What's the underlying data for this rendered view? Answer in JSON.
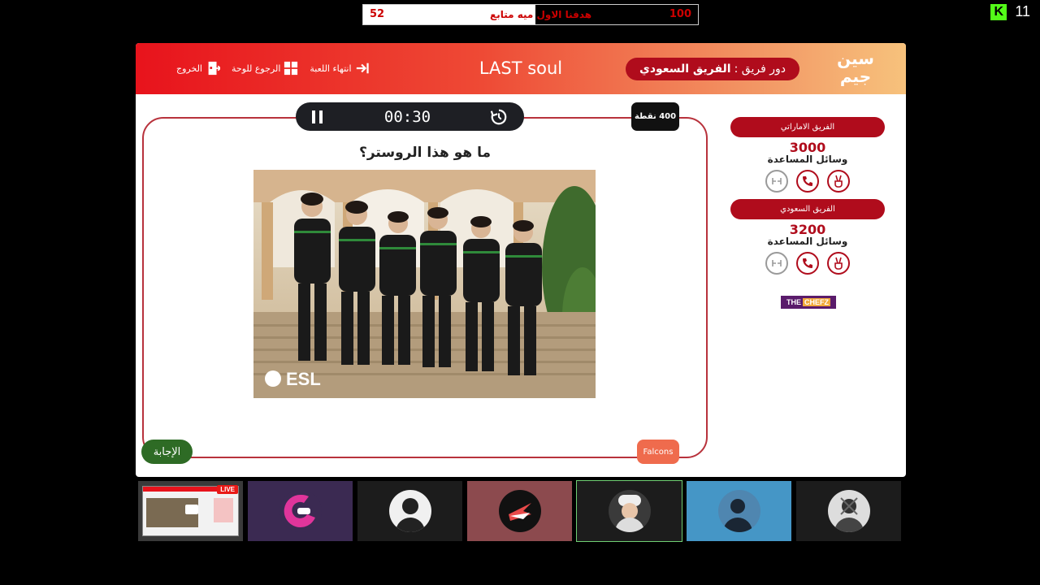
{
  "overlay": {
    "goal_count": "52",
    "goal_text": "هدفنا الاول ميه متابع",
    "goal_target": "100",
    "viewer_count": "11",
    "platform_logo": "K"
  },
  "header": {
    "brand": "سين جيم",
    "turn_label": "دور فريق :",
    "turn_team": "الفريق السعودي",
    "title": "LAST soul",
    "nav": [
      {
        "label": "انتهاء اللعبة",
        "icon": "arrow-right-icon"
      },
      {
        "label": "الرجوع للوحة",
        "icon": "grid-icon"
      },
      {
        "label": "الخروج",
        "icon": "exit-icon"
      }
    ]
  },
  "board": {
    "timer": "00:30",
    "points": "400 نقطة",
    "question": "ما هو هذا الروستر؟",
    "image_watermark": "ESL",
    "answer_button": "الإجابة",
    "tag": "Falcons"
  },
  "teams": [
    {
      "name": "الفريق الاماراتي",
      "score": "3000",
      "help_label": "وسائل المساعدة"
    },
    {
      "name": "الفريق السعودي",
      "score": "3200",
      "help_label": "وسائل المساعدة"
    }
  ],
  "sponsor": {
    "part1": "THE",
    "part2": "CHEFZ"
  },
  "tiles": [
    {
      "name": "stream-preview",
      "bg": "#3a3a3a",
      "live": "LIVE"
    },
    {
      "name": "participant-2",
      "bg": "#3b2a52"
    },
    {
      "name": "participant-3",
      "bg": "#1c1c1c"
    },
    {
      "name": "participant-4",
      "bg": "#8c4a4e"
    },
    {
      "name": "participant-5",
      "bg": "#1c1c1c"
    },
    {
      "name": "participant-6",
      "bg": "#4596c6"
    },
    {
      "name": "participant-7",
      "bg": "#1c1c1c"
    }
  ],
  "colors": {
    "accent": "#b00c1c",
    "header_start": "#e8131c",
    "header_end": "#f7c27c",
    "answer": "#2e6b25"
  }
}
